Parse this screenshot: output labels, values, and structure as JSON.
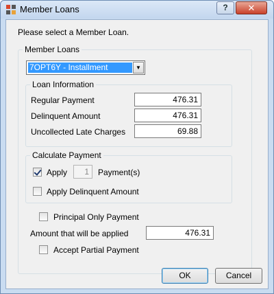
{
  "window": {
    "title": "Member Loans",
    "help_glyph": "?",
    "close_glyph": "✕"
  },
  "prompt": "Please select a Member Loan.",
  "member_loans": {
    "group_label": "Member Loans",
    "selected_loan": "7OPT6Y - Installment"
  },
  "loan_information": {
    "group_label": "Loan Information",
    "rows": [
      {
        "label": "Regular Payment",
        "value": "476.31"
      },
      {
        "label": "Delinquent Amount",
        "value": "476.31"
      },
      {
        "label": "Uncollected Late Charges",
        "value": "69.88"
      }
    ]
  },
  "calculate_payment": {
    "group_label": "Calculate Payment",
    "apply_label": "Apply",
    "apply_checked": true,
    "payment_count": "1",
    "payments_suffix": "Payment(s)",
    "apply_delinquent_label": "Apply Delinquent Amount",
    "apply_delinquent_checked": false
  },
  "principal_only_label": "Principal Only Payment",
  "amount_applied": {
    "label": "Amount that will be applied",
    "value": "476.31"
  },
  "accept_partial_label": "Accept Partial Payment",
  "buttons": {
    "ok": "OK",
    "cancel": "Cancel"
  }
}
